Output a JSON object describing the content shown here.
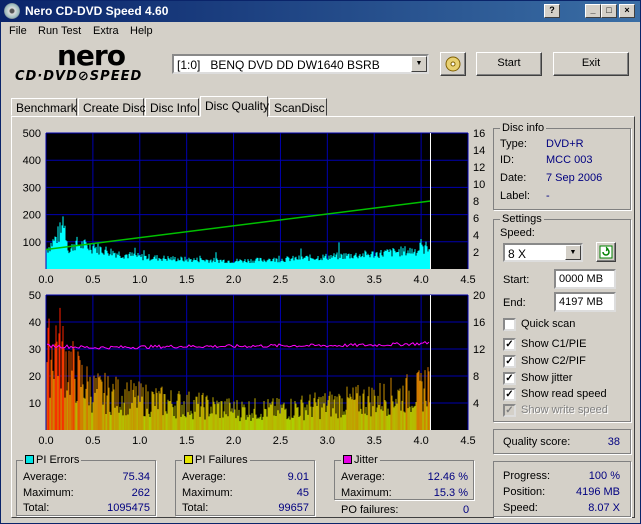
{
  "app": {
    "title": "Nero CD-DVD Speed 4.60",
    "window_buttons": [
      "?",
      "_",
      "□",
      "×"
    ]
  },
  "menu": [
    "File",
    "Run Test",
    "Extra",
    "Help"
  ],
  "logo": {
    "line1": "nero",
    "line2": "CD·DVD⊘SPEED"
  },
  "drive": {
    "value": "[1:0]   BENQ DVD DD DW1640 BSRB"
  },
  "buttons": {
    "start": "Start",
    "exit": "Exit"
  },
  "tabs": [
    {
      "label": "Benchmark"
    },
    {
      "label": "Create Disc"
    },
    {
      "label": "Disc Info"
    },
    {
      "label": "Disc Quality",
      "active": true
    },
    {
      "label": "ScanDisc"
    }
  ],
  "disc_info": {
    "title": "Disc info",
    "type_label": "Type:",
    "type": "DVD+R",
    "id_label": "ID:",
    "id": "MCC 003",
    "date_label": "Date:",
    "date": "7 Sep 2006",
    "label_label": "Label:",
    "label": "-"
  },
  "settings": {
    "title": "Settings",
    "speed_label": "Speed:",
    "speed": "8 X",
    "start_label": "Start:",
    "start": "0000 MB",
    "end_label": "End:",
    "end": "4197 MB",
    "checks": [
      {
        "label": "Quick scan",
        "checked": false
      },
      {
        "label": "Show C1/PIE",
        "checked": true
      },
      {
        "label": "Show C2/PIF",
        "checked": true
      },
      {
        "label": "Show jitter",
        "checked": true
      },
      {
        "label": "Show read speed",
        "checked": true
      },
      {
        "label": "Show write speed",
        "checked": true,
        "disabled": true
      }
    ]
  },
  "quality": {
    "label": "Quality score:",
    "value": "38"
  },
  "pi_errors": {
    "title": "PI Errors",
    "color": "#00e5e5",
    "avg_label": "Average:",
    "avg": "75.34",
    "max_label": "Maximum:",
    "max": "262",
    "total_label": "Total:",
    "total": "1095475"
  },
  "pi_failures": {
    "title": "PI Failures",
    "color": "#e5e500",
    "avg_label": "Average:",
    "avg": "9.01",
    "max_label": "Maximum:",
    "max": "45",
    "total_label": "Total:",
    "total": "99657"
  },
  "jitter": {
    "title": "Jitter",
    "color": "#e500e5",
    "avg_label": "Average:",
    "avg": "12.46 %",
    "max_label": "Maximum:",
    "max": "15.3 %",
    "po_label": "PO failures:",
    "po": "0"
  },
  "progress": {
    "progress_label": "Progress:",
    "progress": "100 %",
    "position_label": "Position:",
    "position": "4196 MB",
    "speed_label": "Speed:",
    "speed": "8.07 X"
  },
  "chart_data": [
    {
      "type": "area",
      "series": [
        {
          "name": "PI Errors",
          "color": "#00ffff"
        },
        {
          "name": "Read speed",
          "color": "#00c000"
        }
      ],
      "xlim": [
        0,
        4.5
      ],
      "ylim": [
        0,
        500
      ],
      "y2lim": [
        0,
        16
      ],
      "x_ticks": [
        "0.0",
        "0.5",
        "1.0",
        "1.5",
        "2.0",
        "2.5",
        "3.0",
        "3.5",
        "4.0",
        "4.5"
      ],
      "y_ticks": [
        "500",
        "400",
        "300",
        "200",
        "100"
      ],
      "y2_ticks": [
        "16",
        "14",
        "12",
        "10",
        "8",
        "6",
        "4",
        "2"
      ],
      "pie_profile": {
        "x": [
          0.0,
          0.1,
          0.2,
          0.25,
          0.3,
          0.5,
          0.8,
          1.0,
          1.5,
          2.0,
          2.5,
          3.0,
          3.5,
          3.8,
          4.0,
          4.1
        ],
        "y": [
          70,
          110,
          160,
          60,
          95,
          80,
          55,
          45,
          35,
          30,
          35,
          45,
          55,
          65,
          70,
          90
        ]
      },
      "read_speed": {
        "x": [
          0.0,
          4.1
        ],
        "y": [
          2.3,
          8.0
        ]
      },
      "end_x": 4.1
    },
    {
      "type": "bar",
      "series": [
        {
          "name": "PI Failures",
          "color": "#ffff00"
        },
        {
          "name": "Jitter",
          "color": "#ff00ff"
        }
      ],
      "xlim": [
        0,
        4.5
      ],
      "ylim": [
        0,
        50
      ],
      "y2lim": [
        0,
        20
      ],
      "x_ticks": [
        "0.0",
        "0.5",
        "1.0",
        "1.5",
        "2.0",
        "2.5",
        "3.0",
        "3.5",
        "4.0",
        "4.5"
      ],
      "y_ticks": [
        "50",
        "40",
        "30",
        "20",
        "10"
      ],
      "y2_ticks": [
        "20",
        "16",
        "12",
        "8",
        "4"
      ],
      "pif_profile": {
        "x": [
          0.0,
          0.1,
          0.2,
          0.3,
          0.5,
          1.0,
          1.5,
          2.0,
          2.5,
          3.0,
          3.5,
          4.0,
          4.1
        ],
        "y": [
          25,
          35,
          28,
          22,
          15,
          12,
          10,
          8,
          8,
          10,
          12,
          15,
          20
        ]
      },
      "jitter": {
        "x": [
          0.0,
          0.5,
          1.0,
          1.5,
          2.0,
          2.5,
          3.0,
          3.5,
          4.0,
          4.1
        ],
        "y": [
          12.5,
          12.2,
          12.3,
          12.4,
          12.4,
          12.5,
          12.5,
          12.6,
          12.8,
          13.0
        ]
      },
      "end_x": 4.1
    }
  ]
}
